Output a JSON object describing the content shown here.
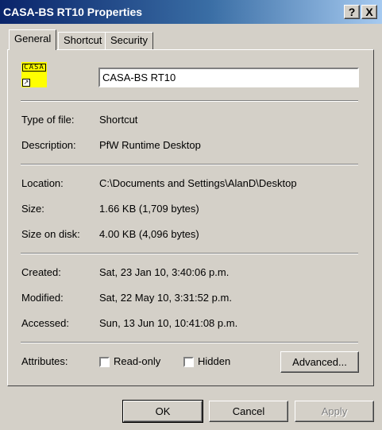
{
  "window": {
    "title": "CASA-BS  RT10 Properties"
  },
  "titlebar_buttons": {
    "help": "?",
    "close": "X"
  },
  "tabs": [
    {
      "label": "General",
      "active": true
    },
    {
      "label": "Shortcut",
      "active": false
    },
    {
      "label": "Security",
      "active": false
    }
  ],
  "file": {
    "icon": "casa-shortcut-icon",
    "icon_text": "CASA",
    "name": "CASA-BS  RT10"
  },
  "details": {
    "type_label": "Type of file:",
    "type_value": "Shortcut",
    "description_label": "Description:",
    "description_value": "PfW Runtime Desktop",
    "location_label": "Location:",
    "location_value": "C:\\Documents and Settings\\AlanD\\Desktop",
    "size_label": "Size:",
    "size_value": "1.66 KB (1,709 bytes)",
    "size_on_disk_label": "Size on disk:",
    "size_on_disk_value": "4.00 KB (4,096 bytes)",
    "created_label": "Created:",
    "created_value": "Sat, 23 Jan 10, 3:40:06 p.m.",
    "modified_label": "Modified:",
    "modified_value": "Sat, 22 May 10, 3:31:52 p.m.",
    "accessed_label": "Accessed:",
    "accessed_value": "Sun, 13 Jun 10, 10:41:08 p.m."
  },
  "attributes": {
    "label": "Attributes:",
    "read_only_label": "Read-only",
    "read_only_checked": false,
    "hidden_label": "Hidden",
    "hidden_checked": false,
    "advanced_label": "Advanced..."
  },
  "buttons": {
    "ok": "OK",
    "cancel": "Cancel",
    "apply": "Apply"
  },
  "colors": {
    "face": "#d4d0c8",
    "titlebar_start": "#0a246a",
    "titlebar_end": "#a6caf0",
    "icon_yellow": "#ffff00"
  }
}
